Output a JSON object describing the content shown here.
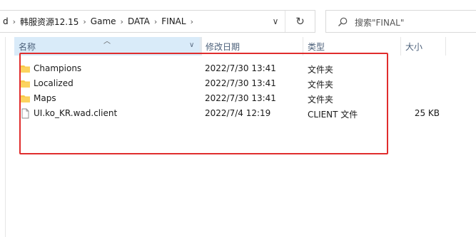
{
  "address_bar": {
    "crumbs": [
      "d",
      "韩服资源12.15",
      "Game",
      "DATA",
      "FINAL"
    ],
    "dropdown_glyph": "∨",
    "refresh_glyph": "↻"
  },
  "search": {
    "placeholder": "搜索\"FINAL\""
  },
  "columns": {
    "name": "名称",
    "date": "修改日期",
    "type": "类型",
    "size": "大小"
  },
  "files": [
    {
      "name": "Champions",
      "date": "2022/7/30 13:41",
      "type": "文件夹",
      "size": "",
      "icon": "folder-icon"
    },
    {
      "name": "Localized",
      "date": "2022/7/30 13:41",
      "type": "文件夹",
      "size": "",
      "icon": "folder-icon"
    },
    {
      "name": "Maps",
      "date": "2022/7/30 13:41",
      "type": "文件夹",
      "size": "",
      "icon": "folder-icon"
    },
    {
      "name": "UI.ko_KR.wad.client",
      "date": "2022/7/4 12:19",
      "type": "CLIENT 文件",
      "size": "25 KB",
      "icon": "file-icon"
    }
  ],
  "colors": {
    "header_selected_bg": "#d9ebf9",
    "folder_yellow": "#f8c94a",
    "highlight_red": "#e02d2d"
  }
}
